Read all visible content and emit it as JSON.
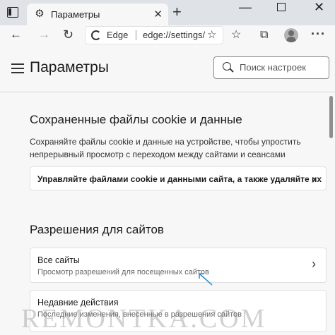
{
  "browser": {
    "tab_title": "Параметры",
    "new_tab_symbol": "+",
    "address": {
      "brand": "Edge",
      "url": "edge://settings/content"
    }
  },
  "page": {
    "title": "Параметры",
    "search_placeholder": "Поиск настроек",
    "cookies_section": {
      "title": "Сохраненные файлы cookie и данные",
      "description": "Сохраняйте файлы cookie и данные на устройстве, чтобы упростить непрерывный просмотр с переходом между сайтами и сеансами",
      "manage_link": "Управляйте файлами cookie и данными сайта, а также удаляйте их"
    },
    "permissions_section": {
      "title": "Разрешения для сайтов",
      "all_sites": {
        "label": "Все сайты",
        "description": "Просмотр разрешений для посещенных сайтов"
      },
      "recent_activity": {
        "label": "Недавние действия",
        "description": "Последние изменения, внесенные в разрешения сайтов"
      }
    }
  },
  "watermark": "REMONTKA.COM",
  "icons": [
    "tabs-icon",
    "gear-icon",
    "close-icon",
    "back-icon",
    "forward-icon",
    "refresh-icon",
    "edge-logo-icon",
    "favorites-add-icon",
    "collections-icon",
    "extensions-icon",
    "avatar",
    "more-icon",
    "hamburger-icon",
    "search-icon",
    "chevron-right-icon"
  ],
  "colors": {
    "tabbar": "#dfe3e8",
    "page_bg": "#f7f7f7",
    "card_bg": "#ffffff",
    "pointer_arrow": "#2d8fd5"
  }
}
